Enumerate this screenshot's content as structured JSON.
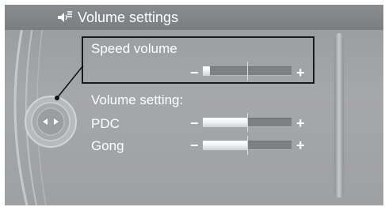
{
  "header": {
    "title": "Volume settings",
    "icon": "speaker-settings-icon"
  },
  "speed_volume": {
    "label": "Speed volume",
    "minus": "−",
    "plus": "+",
    "level": 0.08
  },
  "volume_setting": {
    "heading": "Volume setting:"
  },
  "pdc": {
    "label": "PDC",
    "minus": "−",
    "plus": "+",
    "level": 0.5
  },
  "gong": {
    "label": "Gong",
    "minus": "−",
    "plus": "+",
    "level": 0.5
  },
  "colors": {
    "text": "#ffffff",
    "panel": "#a3a4a6",
    "header": "#838486",
    "selection_border": "#1a1a1a"
  }
}
